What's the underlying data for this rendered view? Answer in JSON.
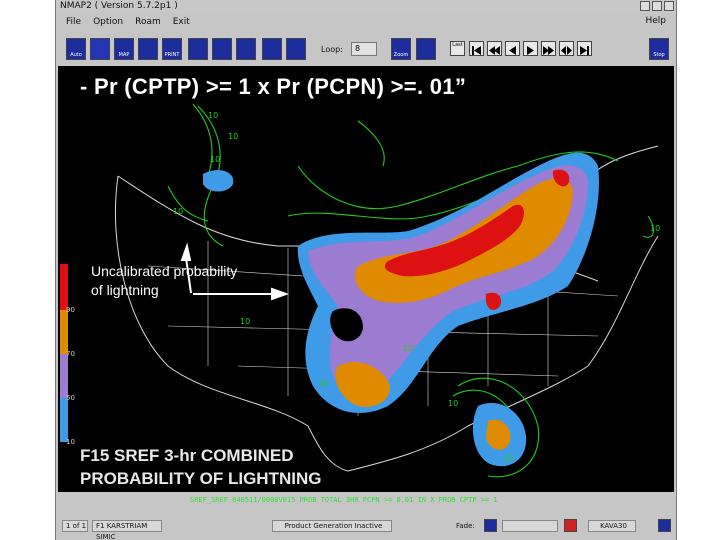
{
  "window": {
    "title": "NMAP2 ( Version 5.7.2p1 )",
    "menu": [
      "File",
      "Option",
      "Roam",
      "Exit"
    ],
    "help": "Help"
  },
  "toolbar": {
    "tools": [
      "Auto",
      "",
      "MAP",
      "",
      "PRINT",
      "",
      "",
      "",
      "",
      ""
    ],
    "loop_label": "Loop:",
    "loop_value": "8",
    "zoom_label": "Zoom",
    "last_label": "Last",
    "stop_label": "Stop"
  },
  "slide": {
    "headline": "- Pr (CPTP) >= 1 x Pr (PCPN) >=. 01”",
    "annotation_line1": "Uncalibrated probability",
    "annotation_line2": "of lightning",
    "caption_line1": "F15 SREF 3-hr COMBINED",
    "caption_line2": "PROBABILITY OF LIGHTNING"
  },
  "map": {
    "contour_labels": [
      "10",
      "10",
      "10",
      "10",
      "10",
      "10",
      "10",
      "10",
      "10",
      "10"
    ],
    "colorbar_ticks": [
      "90",
      "70",
      "50",
      "10"
    ],
    "colors": {
      "red": "#dd1111",
      "orange": "#e08a00",
      "purple": "#9b7cd0",
      "blue": "#3f9ae8",
      "green": "#22cc22",
      "borders": "#d8d8d8"
    }
  },
  "ticker": "SREF_SREF 040511/0000V015 PROB TOTAL 3HR PCPN >= 0.01 IN X PROB CPTP >= 1",
  "status": {
    "frame": "1 of 1",
    "frame_time": "F1 KARSTRIAM SIMIC",
    "message": "Product Generation Inactive",
    "fade_label": "Fade:",
    "site": "KAVA30"
  }
}
